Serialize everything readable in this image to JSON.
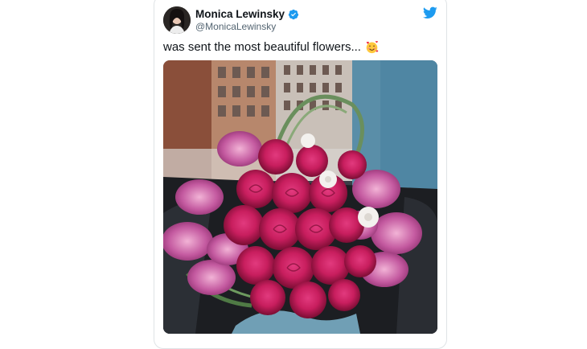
{
  "tweet": {
    "display_name": "Monica Lewinsky",
    "handle": "@MonicaLewinsky",
    "text": "was sent the most beautiful flowers...",
    "emoji": "smiling-face-with-hearts",
    "verified": true
  },
  "icons": {
    "verified": "verified-badge-icon",
    "logo": "twitter-bird-icon"
  },
  "colors": {
    "twitter_blue": "#1d9bf0",
    "text": "#0f1419",
    "secondary": "#536471"
  },
  "media": {
    "description_label": "photo"
  }
}
